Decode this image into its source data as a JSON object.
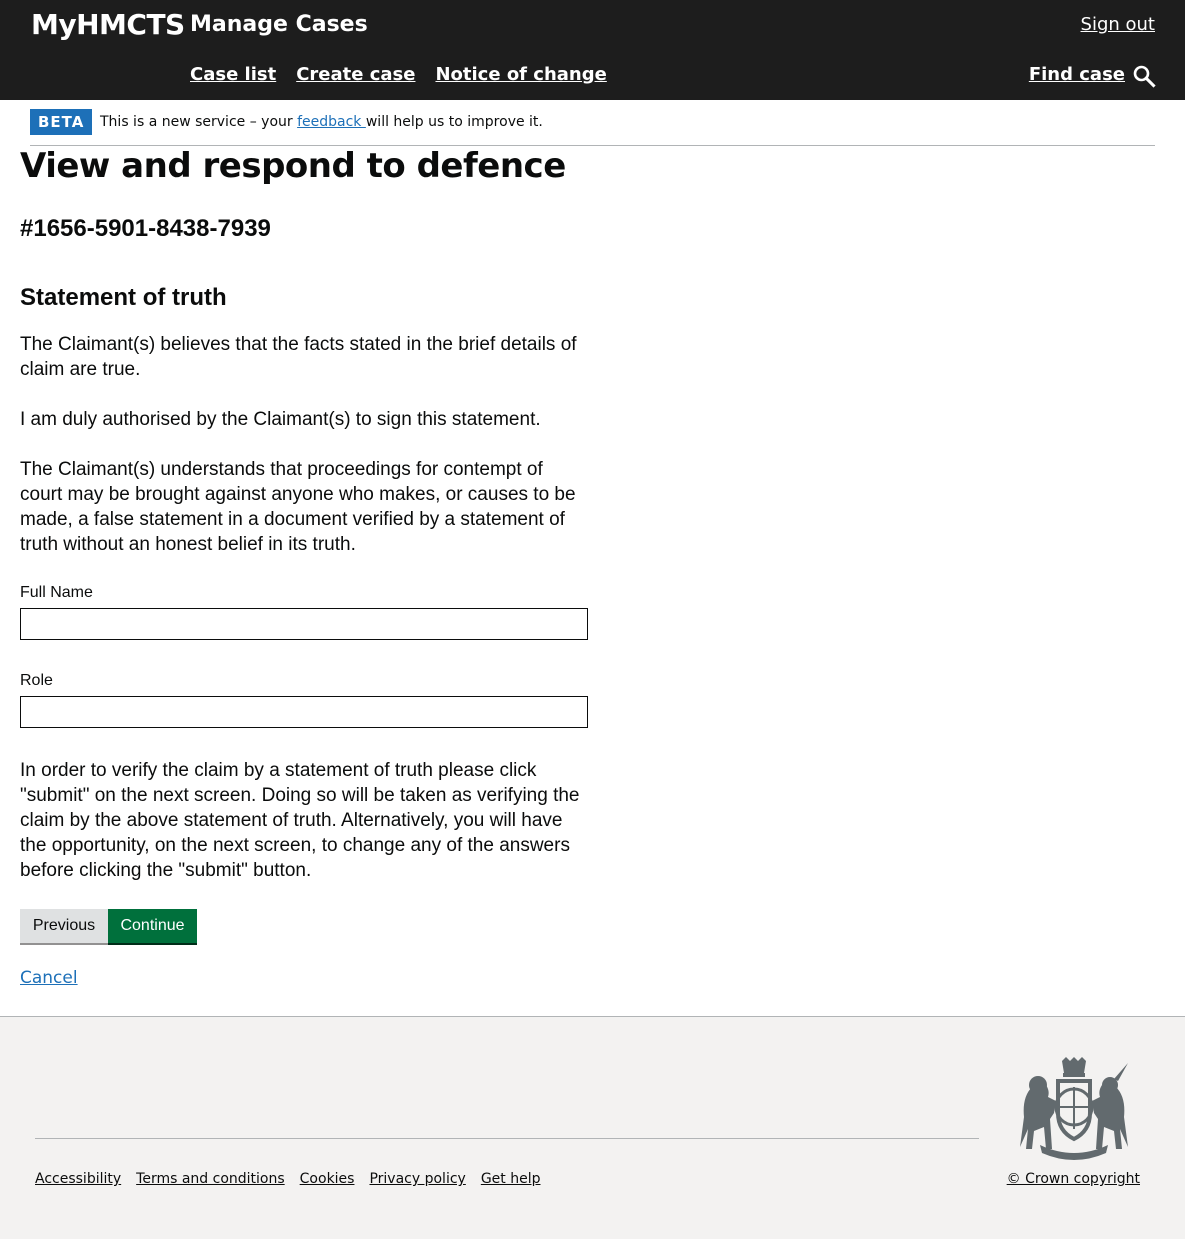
{
  "header": {
    "brand": "MyHMCTS",
    "service_name": "Manage Cases",
    "sign_out": "Sign out",
    "nav": [
      "Case list",
      "Create case",
      "Notice of change"
    ],
    "find_case": "Find case"
  },
  "phase_banner": {
    "tag": "BETA",
    "text_before": "This is a new service – your ",
    "link": "feedback ",
    "text_after": "will help us to improve it."
  },
  "page": {
    "title": "View and respond to defence",
    "case_reference": "#1656-5901-8438-7939",
    "section_heading": "Statement of truth",
    "paragraphs": [
      "The Claimant(s) believes that the facts stated in the brief details of claim are true.",
      "I am duly authorised by the Claimant(s) to sign this statement.",
      "The Claimant(s) understands that proceedings for contempt of court may be brought against anyone who makes, or causes to be made, a false statement in a document verified by a statement of truth without an honest belief in its truth."
    ],
    "fields": {
      "full_name": {
        "label": "Full Name",
        "value": ""
      },
      "role": {
        "label": "Role",
        "value": ""
      }
    },
    "instruction": "In order to verify the claim by a statement of truth please click \"submit\" on the next screen. Doing so will be taken as verifying the claim by the above statement of truth. Alternatively, you will have the opportunity, on the next screen, to change any of the answers before clicking the \"submit\" button.",
    "buttons": {
      "previous": "Previous",
      "continue": "Continue"
    },
    "cancel": "Cancel"
  },
  "footer": {
    "links": [
      "Accessibility",
      "Terms and conditions",
      "Cookies",
      "Privacy policy",
      "Get help"
    ],
    "copyright": "© Crown copyright"
  },
  "colors": {
    "header_bg": "#1d1d1d",
    "link": "#1d70b8",
    "beta_tag": "#1d70b8",
    "continue_button": "#00703c",
    "previous_button": "#dfe1e2",
    "footer_bg": "#f3f2f1"
  },
  "icons": [
    "search-icon",
    "royal-crest-icon"
  ]
}
